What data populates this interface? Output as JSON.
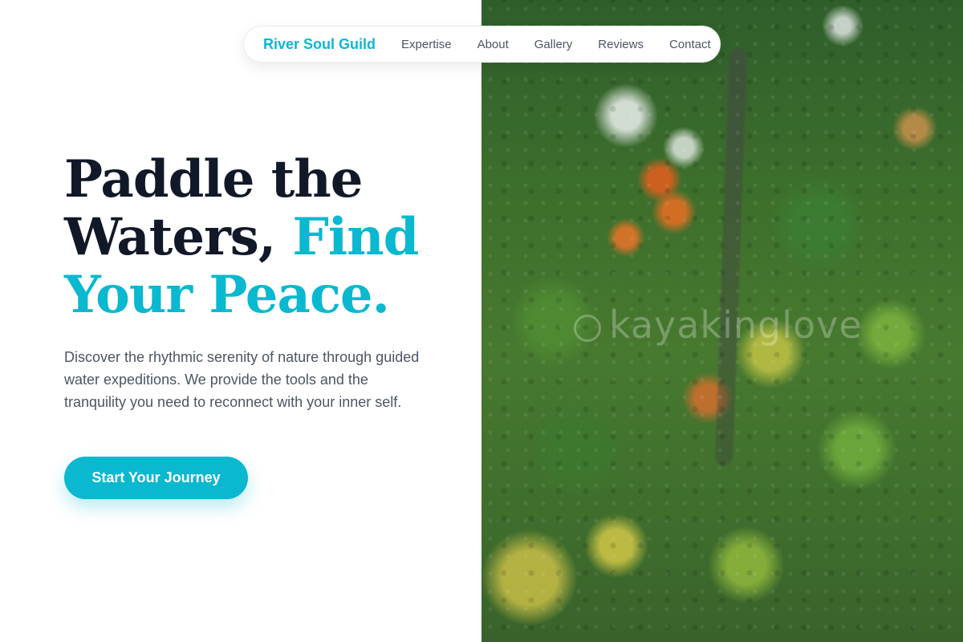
{
  "nav": {
    "brand": "River Soul Guild",
    "links": [
      "Expertise",
      "About",
      "Gallery",
      "Reviews",
      "Contact"
    ]
  },
  "hero": {
    "headline_dark": "Paddle the Waters, ",
    "headline_accent": "Find Your Peace.",
    "description": "Discover the rhythmic serenity of nature through guided water expeditions. We provide the tools and the tranquility you need to reconnect with your inner self.",
    "cta_label": "Start Your Journey"
  },
  "image": {
    "watermark": "kayakinglove"
  },
  "colors": {
    "accent": "#0ab8d0",
    "heading": "#111827",
    "body_text": "#4b5563",
    "background": "#ffffff"
  }
}
